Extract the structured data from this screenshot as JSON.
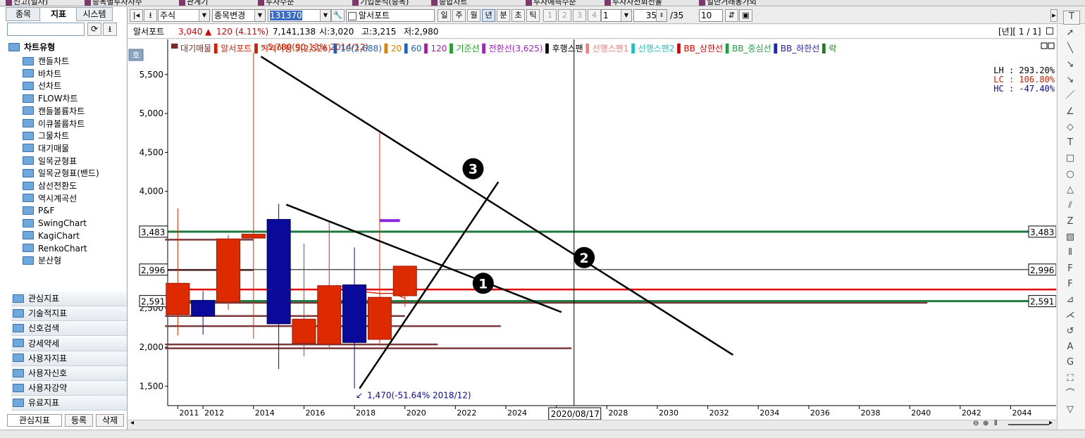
{
  "top_tabs": [
    "신고(일자)",
    "종목별투자자주",
    "관계기",
    "투자수준",
    "기업분석(종목)",
    "종합차트",
    "투자예측수준",
    "투자자전회전율",
    "일반거래동가외"
  ],
  "left_tabs": [
    "종목",
    "지표",
    "시스템"
  ],
  "left_active_tab": 1,
  "search_placeholder": "",
  "tree_header": "차트유형",
  "tree_items": [
    "캔들차트",
    "바차트",
    "선차트",
    "FLOW차트",
    "캔들볼륨차트",
    "이큐볼륨차트",
    "그물차트",
    "대기매물",
    "일목균형표",
    "일목균형표(밴드)",
    "삼선전환도",
    "역시계곡선",
    "P&F",
    "SwingChart",
    "KagiChart",
    "RenkoChart",
    "분산형"
  ],
  "categories": [
    "관심지표",
    "기술적지표",
    "신호검색",
    "강세약세",
    "사용자지표",
    "사용자신호",
    "사용자강약",
    "유료지표"
  ],
  "left_bottom": {
    "tab": "관심지표",
    "register": "등록",
    "delete": "삭제"
  },
  "toolbar": {
    "market": "주식",
    "change_code": "종목변경",
    "code": "131370",
    "name": "알서포트",
    "periods": [
      "일",
      "주",
      "월",
      "년",
      "분",
      "초",
      "틱"
    ],
    "selected_period": "년",
    "nums": [
      "1",
      "2",
      "3",
      "4"
    ],
    "count_box": "1",
    "display": "35",
    "total": "/35",
    "zoom": "10"
  },
  "info": {
    "name": "알서포트",
    "price": "3,040",
    "arrow": "▲",
    "change": "120 (4.11%)",
    "volume": "7,141,138",
    "open": "시:3,020",
    "high": "고:3,215",
    "low": "저:2,980",
    "page": "[년][ 1 / 1]"
  },
  "legend": [
    {
      "text": "대기매물",
      "color": "#7a2a2a"
    },
    {
      "text": "알서포트",
      "color": "#d02000"
    },
    {
      "text": "가격이평 5(2,526)",
      "color": "#d02000"
    },
    {
      "text": "10(2,688)",
      "color": "#2060c0"
    },
    {
      "text": "20",
      "color": "#e08000"
    },
    {
      "text": "60",
      "color": "#2060c0"
    },
    {
      "text": "120",
      "color": "#a020a0"
    },
    {
      "text": "기준선",
      "color": "#20a020"
    },
    {
      "text": "전환선(3,625)",
      "color": "#a020c0"
    },
    {
      "text": "후행스팬",
      "color": "#000000"
    },
    {
      "text": "선행스팬1",
      "color": "#f08080"
    },
    {
      "text": "선행스팬2",
      "color": "#20c0c0"
    },
    {
      "text": "BB_상한선",
      "color": "#e00000"
    },
    {
      "text": "BB_중심선",
      "color": "#20a040"
    },
    {
      "text": "BB_하한선",
      "color": "#2020c0"
    },
    {
      "text": "락",
      "color": "#208020"
    }
  ],
  "stats": {
    "lh": "LH :  293.20%",
    "lc": "LC :  106.80%",
    "hc": "HC :  -47.40%"
  },
  "annotations": {
    "high": "5,780(90.13% 2014/12)",
    "low": "1,470(-51.64% 2018/12)",
    "crosshair_date": "2020/08/17"
  },
  "markers": [
    "1",
    "2",
    "3"
  ],
  "ho_label": "호",
  "chart_data": {
    "type": "candlestick",
    "y_ticks": [
      1500,
      2000,
      2500,
      3000,
      3500,
      4000,
      4500,
      5000,
      5500
    ],
    "y_tick_labels": [
      "1,500",
      "2,000",
      "2,500",
      "3,000",
      "3,500",
      "4,000",
      "4,500",
      "5,000",
      "5,500"
    ],
    "ylim": [
      1250,
      5950
    ],
    "x_tick_labels": [
      "2011",
      "2012",
      "2014",
      "2016",
      "2018",
      "2020",
      "2022",
      "2024",
      "2026",
      "2028",
      "2030",
      "2032",
      "2034",
      "2036",
      "2038",
      "2040",
      "2042",
      "2044"
    ],
    "x_tick_years": [
      2011,
      2012,
      2014,
      2016,
      2018,
      2020,
      2022,
      2024,
      2026,
      2028,
      2030,
      2032,
      2034,
      2036,
      2038,
      2040,
      2042,
      2044
    ],
    "xlim": [
      2010.6,
      2045.8
    ],
    "candles": [
      {
        "year": 2011,
        "open": 2420,
        "high": 3780,
        "low": 2150,
        "close": 2820
      },
      {
        "year": 2012,
        "open": 2600,
        "high": 2720,
        "low": 2160,
        "close": 2400
      },
      {
        "year": 2013,
        "open": 2580,
        "high": 3440,
        "low": 2480,
        "close": 3390
      },
      {
        "year": 2014,
        "open": 3400,
        "high": 5780,
        "low": 2110,
        "close": 3450
      },
      {
        "year": 2015,
        "open": 3640,
        "high": 3840,
        "low": 1720,
        "close": 2300
      },
      {
        "year": 2016,
        "open": 2050,
        "high": 3330,
        "low": 1880,
        "close": 2360
      },
      {
        "year": 2017,
        "open": 2040,
        "high": 3600,
        "low": 2000,
        "close": 2790
      },
      {
        "year": 2018,
        "open": 2800,
        "high": 3280,
        "low": 1470,
        "close": 2060
      },
      {
        "year": 2019,
        "open": 2100,
        "high": 4750,
        "low": 2050,
        "close": 2640
      },
      {
        "year": 2020,
        "open": 2660,
        "high": 3020,
        "low": 2520,
        "close": 3040
      }
    ],
    "horizontal_lines": [
      {
        "label": "3,483",
        "value": 3483,
        "color": "#1e7a3e"
      },
      {
        "label": "2,996",
        "value": 2996,
        "color": "#000000"
      },
      {
        "label": "2,591",
        "value": 2591,
        "color": "#1e7a3e"
      }
    ],
    "bb_upper": 2740,
    "price_levels": [
      {
        "value": 3380,
        "from": 2011,
        "to": 2014
      },
      {
        "value": 2990,
        "from": 2011,
        "to": 2014
      },
      {
        "value": 2570,
        "from": 2011,
        "to": 2040.7
      },
      {
        "value": 2400,
        "from": 2011,
        "to": 2020
      },
      {
        "value": 2270,
        "from": 2011,
        "to": 2023.8
      },
      {
        "value": 2035,
        "from": 2011,
        "to": 2021.3
      },
      {
        "value": 1985,
        "from": 2011,
        "to": 2026.6
      }
    ],
    "ma5": [
      [
        2017,
        2740
      ],
      [
        2017.5,
        2780
      ],
      [
        2018,
        2640
      ],
      [
        2018.4,
        2710
      ],
      [
        2019,
        2690
      ],
      [
        2019.5,
        2690
      ],
      [
        2020,
        2630
      ]
    ],
    "purple_segment": {
      "from": 2019,
      "to": 2019.8,
      "value": 3625
    },
    "trend_lines": [
      {
        "id": "1",
        "from": [
          2015.3,
          3830
        ],
        "to": [
          2026.2,
          2450
        ]
      },
      {
        "id": "2",
        "from": [
          2014.3,
          5730
        ],
        "to": [
          2033,
          1900
        ]
      },
      {
        "id": "3",
        "from": [
          2018.2,
          1470
        ],
        "to": [
          2023.7,
          4120
        ]
      }
    ],
    "crosshair_year": 2026.7
  }
}
